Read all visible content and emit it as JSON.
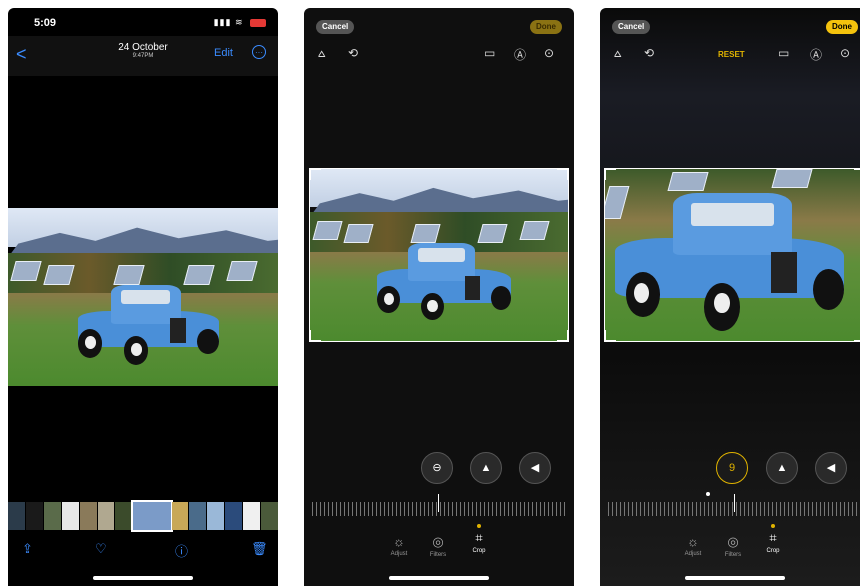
{
  "screen1": {
    "status_time": "5:09",
    "title_date": "24 October",
    "title_time": "9:47PM",
    "edit_label": "Edit",
    "more_label": "···",
    "back_label": "<",
    "toolbar": {
      "share": "⇪",
      "favorite": "♡",
      "info": "ⓘ",
      "delete": "🗑"
    }
  },
  "screen2": {
    "cancel_label": "Cancel",
    "done_label": "Done",
    "tabs": [
      {
        "label": "Adjust",
        "icon": "☼"
      },
      {
        "label": "Filters",
        "icon": "◎"
      },
      {
        "label": "Crop",
        "icon": "⌗"
      }
    ]
  },
  "screen3": {
    "cancel_label": "Cancel",
    "done_label": "Done",
    "reset_label": "RESET",
    "active_value": "9",
    "tabs": [
      {
        "label": "Adjust",
        "icon": "☼"
      },
      {
        "label": "Filters",
        "icon": "◎"
      },
      {
        "label": "Crop",
        "icon": "⌗"
      }
    ]
  },
  "tool_icons": {
    "straighten": "⩟",
    "rotate": "⟲",
    "aspect": "▭",
    "markup": "Ⓐ",
    "more": "⊙"
  },
  "adjust_buttons": {
    "straighten": "⊖",
    "vertical": "▲",
    "horizontal": "◀"
  },
  "colors": {
    "accent_yellow": "#f4c20d",
    "ios_blue": "#3b8cff",
    "truck_blue": "#4a8fd8"
  }
}
